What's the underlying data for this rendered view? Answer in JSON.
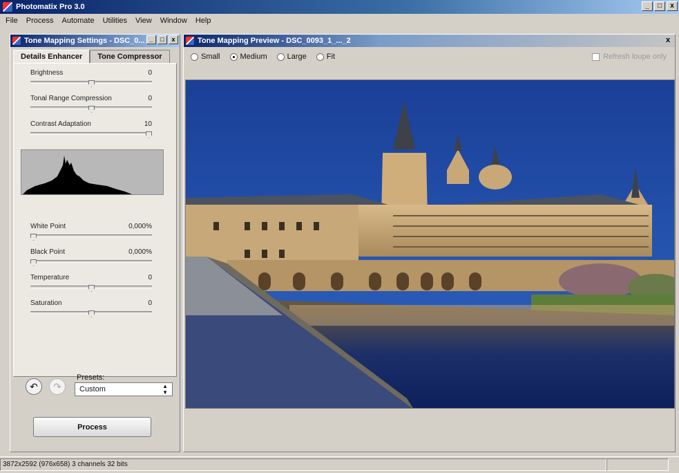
{
  "app": {
    "title": "Photomatix Pro 3.0",
    "controls": {
      "minimize": "_",
      "restore": "□",
      "close": "x"
    }
  },
  "menu": [
    "File",
    "Process",
    "Automate",
    "Utilities",
    "View",
    "Window",
    "Help"
  ],
  "settings_panel": {
    "title": "Tone Mapping Settings - DSC_0...",
    "controls": {
      "minimize": "_",
      "restore": "□",
      "close": "x"
    },
    "tabs": [
      {
        "label": "Details Enhancer",
        "active": true
      },
      {
        "label": "Tone Compressor",
        "active": false
      }
    ],
    "sliders_top": [
      {
        "label": "Brightness",
        "value": "0",
        "level": 0.5
      },
      {
        "label": "Tonal Range Compression",
        "value": "0",
        "level": 0.5
      },
      {
        "label": "Contrast Adaptation",
        "value": "10",
        "level": 1.0
      }
    ],
    "sliders_bottom": [
      {
        "label": "White Point",
        "value": "0,000%",
        "level": 0.0
      },
      {
        "label": "Black Point",
        "value": "0,000%",
        "level": 0.0
      },
      {
        "label": "Temperature",
        "value": "0",
        "level": 0.5
      },
      {
        "label": "Saturation",
        "value": "0",
        "level": 0.5
      }
    ],
    "presets": {
      "label": "Presets:",
      "selected": "Custom"
    },
    "process_button": "Process"
  },
  "preview": {
    "title": "Tone Mapping Preview - DSC_0093_1_..._2",
    "close": "x",
    "sizes": [
      {
        "label": "Small",
        "selected": false
      },
      {
        "label": "Medium",
        "selected": true
      },
      {
        "label": "Large",
        "selected": false
      },
      {
        "label": "Fit",
        "selected": false
      }
    ],
    "refresh_loupe": {
      "label": "Refresh loupe only",
      "checked": false
    }
  },
  "status": {
    "info": "3872x2592 (976x658) 3 channels 32 bits"
  },
  "colors": {
    "titlebar_active": "#0a246a",
    "window_face": "#d4d0c8",
    "sky": "#1f4fa8"
  }
}
